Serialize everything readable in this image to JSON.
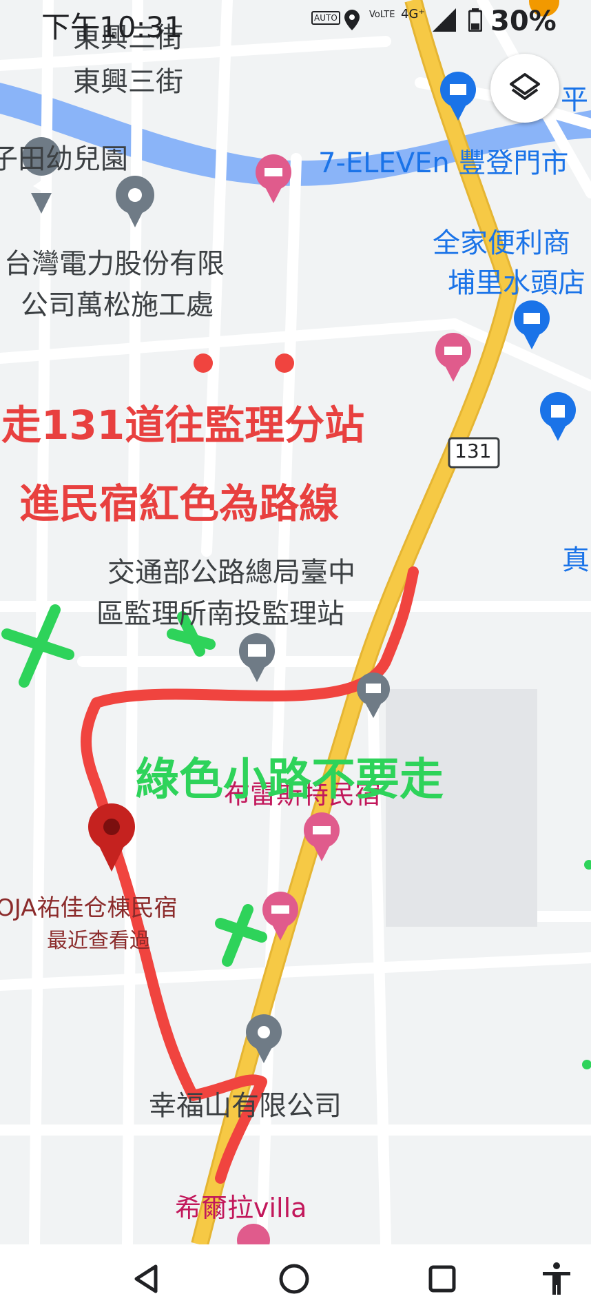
{
  "status_bar": {
    "time": "下午10:31",
    "volte": "VoLTE",
    "network": "4G⁺",
    "battery": "30%",
    "auto": "AUTO"
  },
  "map": {
    "labels": {
      "street_dongxing3": "東興三街",
      "street_top": "東興三街",
      "kindergarten": "子田幼兒園",
      "seven_eleven": "7-ELEVEn 豐登門市",
      "family_mart_1": "全家便利商",
      "family_mart_2": "埔里水頭店",
      "taipower_1": "台灣電力股份有限",
      "taipower_2": "公司萬松施工處",
      "road_131": "131",
      "mvd_1": "交通部公路總局臺中",
      "mvd_2": "區監理所南投監理站",
      "true_partial": "真",
      "buleisi": "布雷斯特民宿",
      "oja_1": "OJA祐佳仓棟民宿",
      "oja_2": "最近查看過",
      "xingfu": "幸福山有限公司",
      "xier": "希爾拉villa",
      "ping_partial": "平"
    },
    "annotations": {
      "red_line1": "走131道往監理分站",
      "red_line2": "進民宿紅色為路線",
      "green": "綠色小路不要走"
    },
    "colors": {
      "route": "#f0443f",
      "warning": "#2ed35a",
      "highway": "#f6c945",
      "river": "#8ab4f8"
    }
  },
  "nav_bar": {
    "back": "back-icon",
    "home": "home-icon",
    "recents": "recents-icon",
    "accessibility": "accessibility-icon"
  }
}
